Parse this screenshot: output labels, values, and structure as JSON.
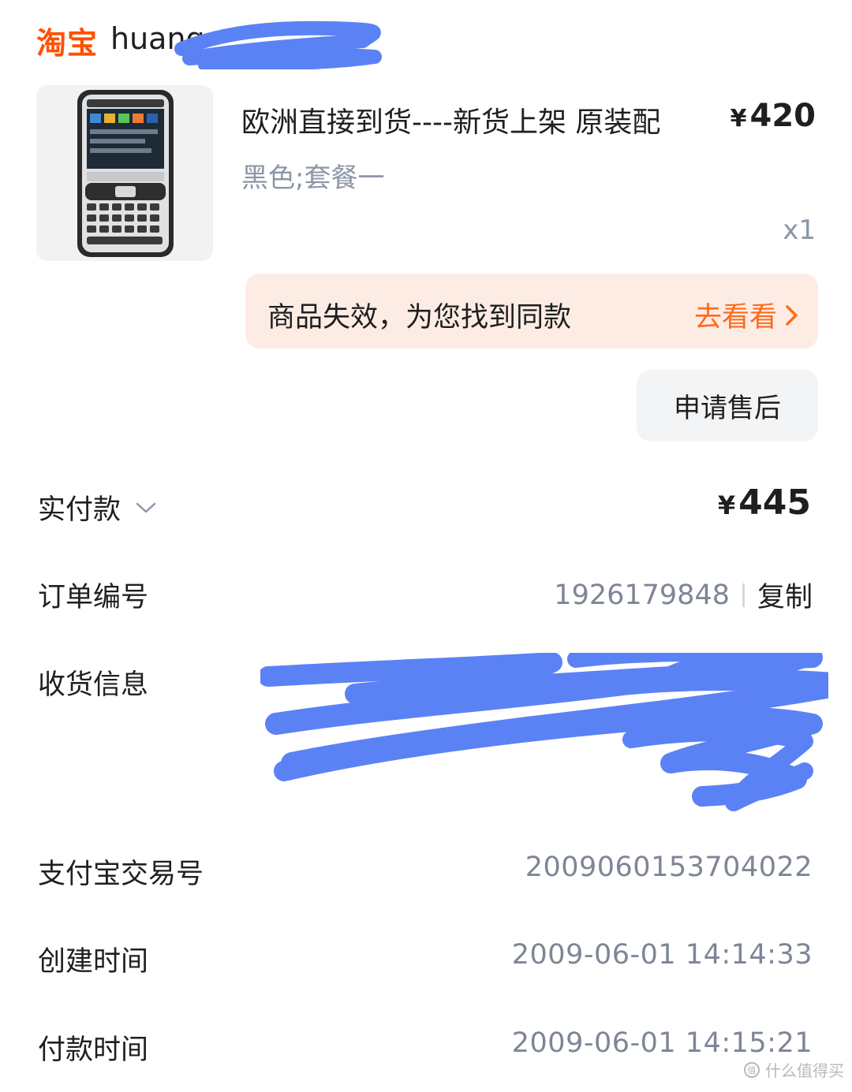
{
  "header": {
    "brand": "淘宝",
    "store_name": "huang"
  },
  "product": {
    "title": "欧洲直接到货----新货上架 原装配",
    "price_symbol": "¥",
    "price": "420",
    "variant": "黑色;套餐一",
    "quantity": "x1"
  },
  "invalid_banner": {
    "message": "商品失效，为您找到同款",
    "link_label": "去看看"
  },
  "after_sale": {
    "label": "申请售后"
  },
  "paid": {
    "label": "实付款",
    "symbol": "¥",
    "amount": "445"
  },
  "order_no": {
    "label": "订单编号",
    "value": "1926179848",
    "copy_label": "复制"
  },
  "shipping": {
    "label": "收货信息"
  },
  "alipay": {
    "label": "支付宝交易号",
    "value": "2009060153704022"
  },
  "created": {
    "label": "创建时间",
    "value": "2009-06-01 14:14:33"
  },
  "payment_time": {
    "label": "付款时间",
    "value": "2009-06-01 14:15:21"
  },
  "watermark": {
    "text": "什么值得买"
  },
  "colors": {
    "brand": "#ff5000",
    "link": "#ff6a1a",
    "redaction": "#5b82f5",
    "muted": "#7d8696"
  }
}
